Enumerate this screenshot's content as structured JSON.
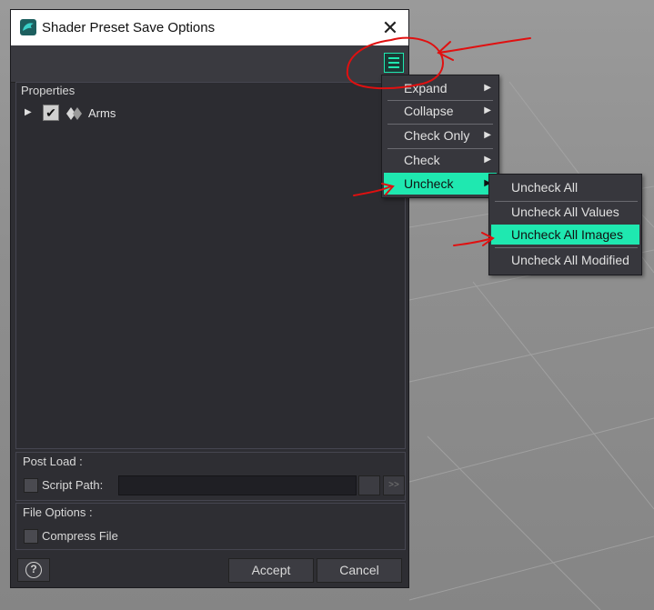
{
  "window": {
    "title": "Shader Preset Save Options",
    "close_glyph": "✕",
    "app_icon": "daz-dragon-icon"
  },
  "toolbar": {
    "menu_icon": "options-menu-icon"
  },
  "properties": {
    "header": "Properties",
    "tree": [
      {
        "label": "Arms",
        "checked": true,
        "expanded": false,
        "icon": "material-icon"
      }
    ]
  },
  "post_load": {
    "title": "Post Load :",
    "script_path_label": "Script Path:",
    "script_path_value": "",
    "more_button": ">>"
  },
  "file_options": {
    "title": "File Options :",
    "compress_label": "Compress File"
  },
  "footer": {
    "help_glyph": "?",
    "accept_label": "Accept",
    "cancel_label": "Cancel"
  },
  "context_menu": {
    "items": [
      {
        "label": "Expand",
        "has_submenu": true
      },
      {
        "label": "Collapse",
        "has_submenu": true
      },
      {
        "label": "Check Only",
        "has_submenu": true
      },
      {
        "label": "Check",
        "has_submenu": true
      },
      {
        "label": "Uncheck",
        "has_submenu": true,
        "highlighted": true
      }
    ],
    "arrow_glyph": "▶"
  },
  "submenu": {
    "items": [
      {
        "label": "Uncheck All"
      },
      {
        "label": "Uncheck All Values"
      },
      {
        "label": "Uncheck All Images",
        "highlighted": true
      },
      {
        "label": "Uncheck All Modified"
      }
    ]
  },
  "colors": {
    "accent": "#1fe8b0",
    "dialog_bg": "#2e2e33",
    "annotation": "#e01010"
  }
}
